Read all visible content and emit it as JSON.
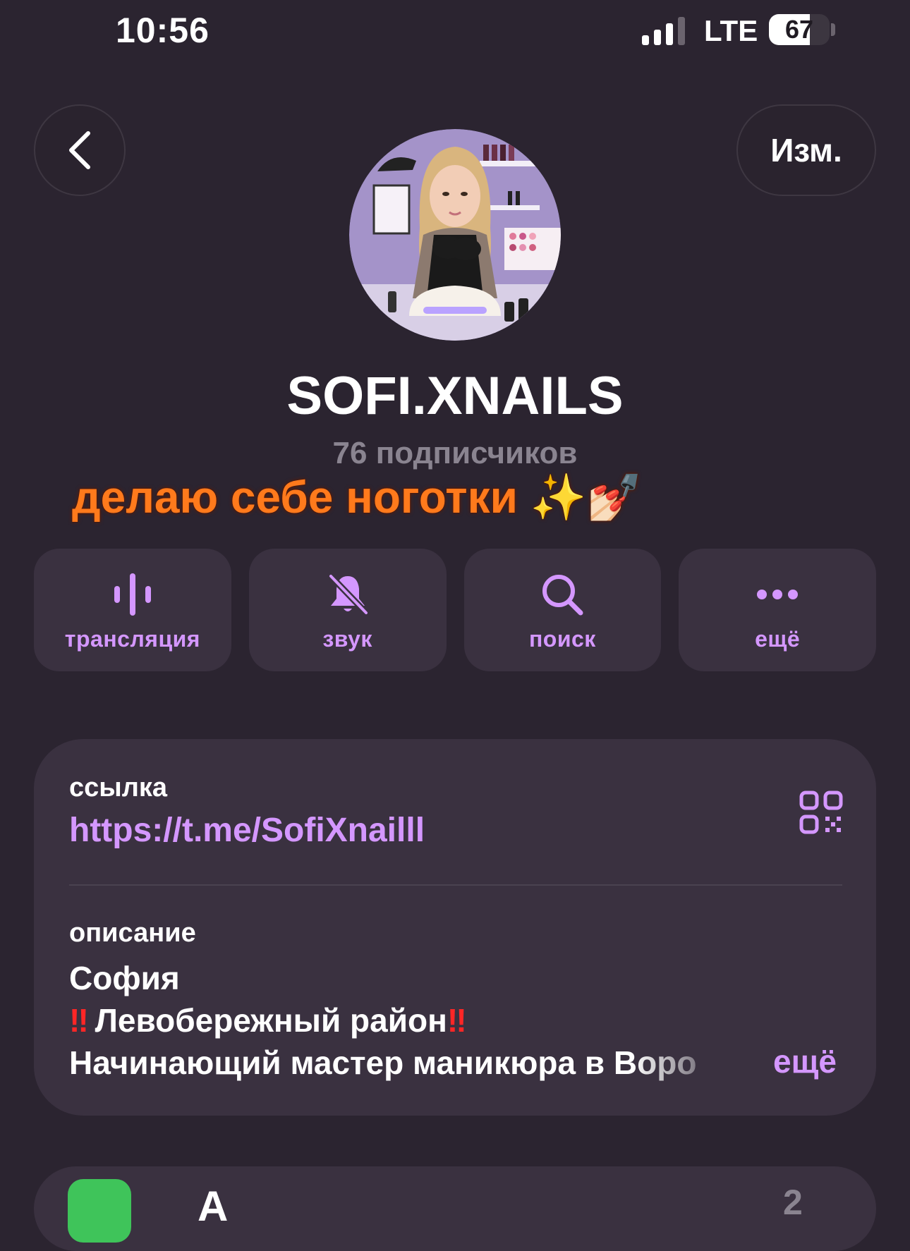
{
  "status_bar": {
    "time": "10:56",
    "network": "LTE",
    "battery": "67",
    "battery_level": 0.67
  },
  "header": {
    "back_icon": "chevron-left-icon",
    "edit_label": "Изм."
  },
  "channel": {
    "title": "SOFI.XNAILS",
    "subscribers": "76 подписчиков",
    "status": "делаю себе ноготки ✨💅🏻"
  },
  "actions": [
    {
      "label": "трансляция",
      "icon": "broadcast-icon"
    },
    {
      "label": "звук",
      "icon": "bell-slash-icon"
    },
    {
      "label": "поиск",
      "icon": "search-icon"
    },
    {
      "label": "ещё",
      "icon": "ellipsis-icon"
    }
  ],
  "info": {
    "link_label": "ссылка",
    "link_value": "https://t.me/SofiXnailll",
    "qr_icon": "qr-code-icon",
    "description_label": "описание",
    "description_lines": [
      "София",
      "Левобережный район",
      "Начинающий мастер маникюра в Воро"
    ],
    "more_label": "ещё"
  },
  "next_row": {
    "text": "А",
    "count": "2"
  },
  "colors": {
    "background": "#2b2430",
    "card": "#3a3140",
    "accent": "#d497ff",
    "status_orange": "#ff7a1c",
    "muted": "#8a8490"
  }
}
